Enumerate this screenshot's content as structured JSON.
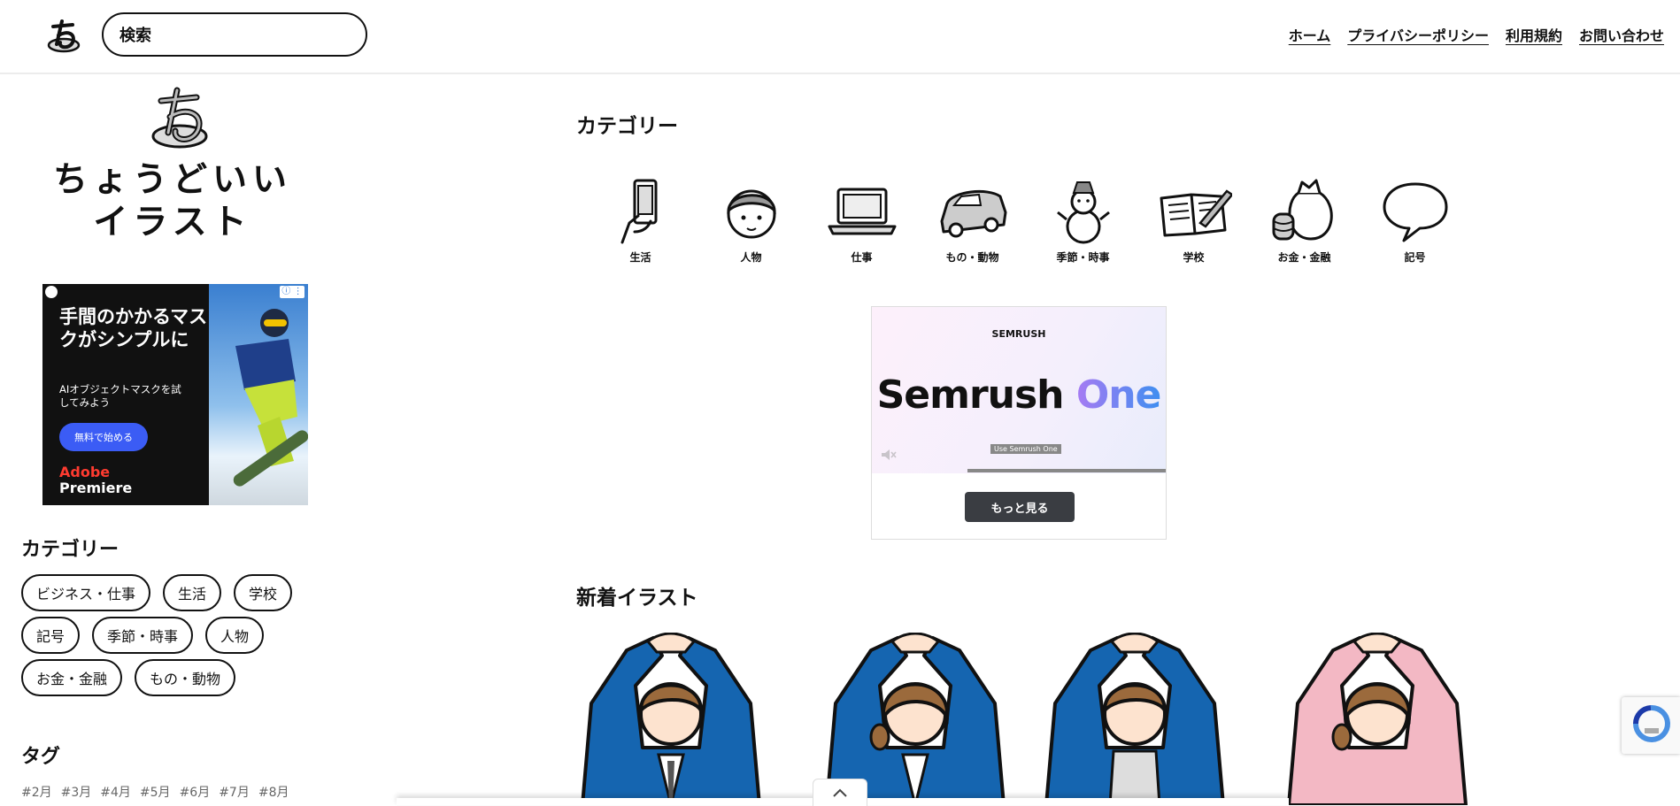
{
  "header": {
    "search_placeholder": "検索",
    "nav": [
      "ホーム",
      "プライバシーポリシー",
      "利用規約",
      "お問い合わせ"
    ]
  },
  "sidebar": {
    "site_title_line1": "ちょうどいい",
    "site_title_line2": "イラスト",
    "ad": {
      "headline": "手間のかかるマスクがシンプルに",
      "sub": "AIオブジェクトマスクを試してみよう",
      "cta": "無料で始める",
      "brand1": "Adobe",
      "brand2": "Premiere"
    },
    "category_heading": "カテゴリー",
    "categories": [
      "ビジネス・仕事",
      "生活",
      "学校",
      "記号",
      "季節・時事",
      "人物",
      "お金・金融",
      "もの・動物"
    ],
    "tag_heading": "タグ",
    "tags": [
      "#2月",
      "#3月",
      "#4月",
      "#5月",
      "#6月",
      "#7月",
      "#8月"
    ]
  },
  "main": {
    "category_heading": "カテゴリー",
    "categories": [
      {
        "label": "生活",
        "icon": "phone-hand-icon"
      },
      {
        "label": "人物",
        "icon": "person-icon"
      },
      {
        "label": "仕事",
        "icon": "laptop-icon"
      },
      {
        "label": "もの・動物",
        "icon": "car-icon"
      },
      {
        "label": "季節・時事",
        "icon": "snowman-icon"
      },
      {
        "label": "学校",
        "icon": "notebook-icon"
      },
      {
        "label": "お金・金融",
        "icon": "money-bag-icon"
      },
      {
        "label": "記号",
        "icon": "speech-bubble-icon"
      }
    ],
    "ad": {
      "brand": "SEMRUSH",
      "title_part1": "Semrush ",
      "title_part2": "One",
      "label": "Use Semrush One",
      "more_button": "もっと見る"
    },
    "new_heading": "新着イラスト"
  },
  "colors": {
    "suit_blue": "#1565b0",
    "pink": "#f3b8c4",
    "hair": "#9b6a3c"
  }
}
